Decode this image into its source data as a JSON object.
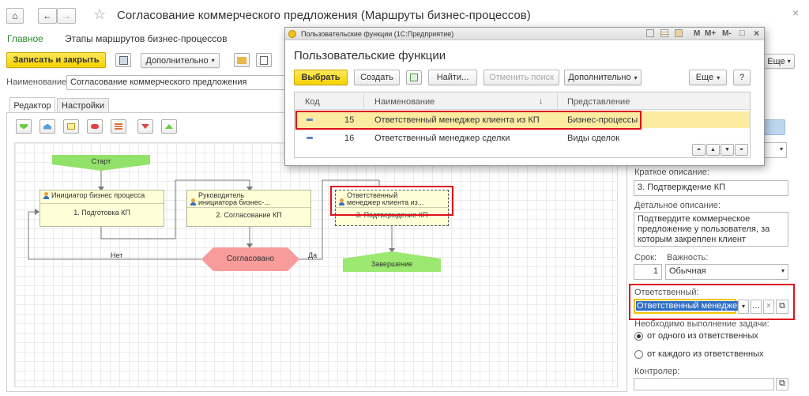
{
  "window": {
    "title": "Согласование коммерческого предложения (Маршруты бизнес-процессов)",
    "star": "☆",
    "close": "×"
  },
  "sections": {
    "main": "Главное",
    "stages": "Этапы маршрутов бизнес-процессов"
  },
  "toolbar": {
    "save_close": "Записать и закрыть",
    "more": "Дополнительно",
    "more_right": "Еще"
  },
  "name_field": {
    "label": "Наименование:",
    "value": "Согласование коммерческого предложения"
  },
  "tabs": [
    {
      "label": "Редактор"
    },
    {
      "label": "Настройки"
    }
  ],
  "diagram": {
    "start": "Старт",
    "n1": {
      "top": "Инициатор бизнес процесса",
      "bottom": "1. Подготовка КП"
    },
    "n2": {
      "top1": "Руководитель",
      "top2": "инициатора бизнес-...",
      "bottom": "2. Согласование КП"
    },
    "n3": {
      "top1": "Ответственный",
      "top2": "менеджер клиента из...",
      "bottom": "3. Подтверждение КП"
    },
    "decision": "Согласовано",
    "no": "Нет",
    "yes": "Да",
    "end": "Завершение"
  },
  "panel": {
    "short_label": "Краткое описание:",
    "short_value": "3. Подтверждение КП",
    "detail_label": "Детальное описание:",
    "detail_value1": "Подтвердите коммерческое",
    "detail_value2": "предложение у пользователя, за",
    "detail_value3": "которым закреплен клиент",
    "term_label": "Срок:",
    "term_value": "1",
    "importance_label": "Важность:",
    "importance_value": "Обычная",
    "resp_label": "Ответственный:",
    "resp_value": "Ответственный менеджер",
    "exec_label": "Необходимо выполнение задачи:",
    "radio1": "от одного из ответственных",
    "radio2": "от каждого из ответственных",
    "controller_label": "Контролер:"
  },
  "dialog": {
    "title_bar": "Пользовательские функции (1С:Предприятие)",
    "heading": "Пользовательские функции",
    "select": "Выбрать",
    "create": "Создать",
    "find": "Найти...",
    "cancel_search": "Отменить поиск",
    "more": "Дополнительно",
    "more2": "Еще",
    "help": "?",
    "columns": {
      "code": "Код",
      "name": "Наименование",
      "sort": "↓",
      "view": "Представление"
    },
    "rows": [
      {
        "code": "15",
        "name": "Ответственный менеджер клиента из КП",
        "view": "Бизнес-процессы"
      },
      {
        "code": "16",
        "name": "Ответственный менеджер сделки",
        "view": "Виды сделок"
      }
    ],
    "winbtns": {
      "m": "M",
      "mplus": "M+",
      "mminus": "M-",
      "restore": "□",
      "close": "×"
    }
  }
}
